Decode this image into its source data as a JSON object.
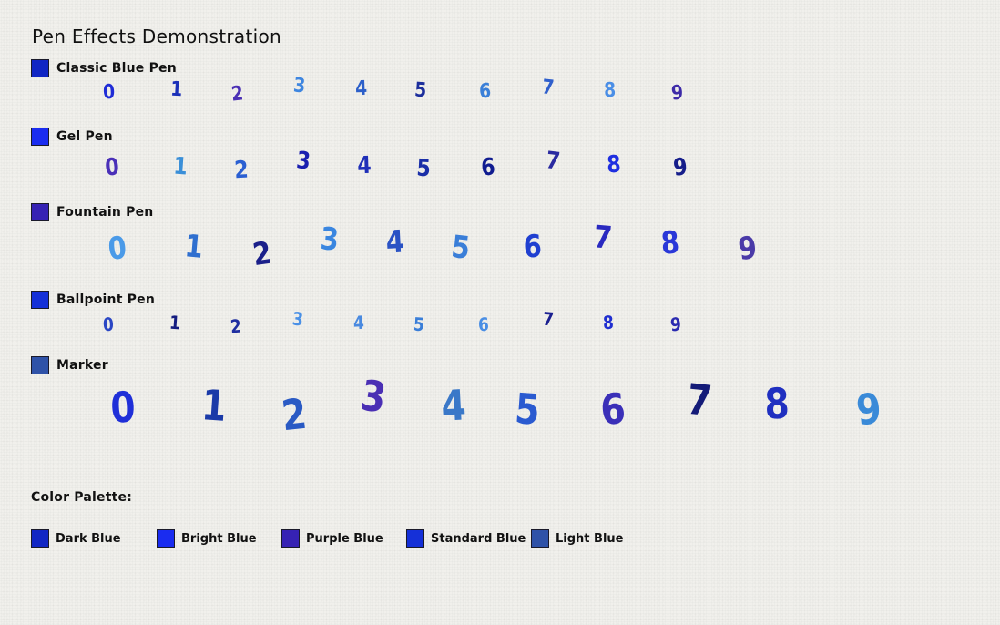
{
  "title": "Pen Effects Demonstration",
  "pens": [
    {
      "name": "Classic Blue Pen",
      "swatch": "#1126c4",
      "digits": [
        {
          "text": "0",
          "color": "#1f2cd6"
        },
        {
          "text": "1",
          "color": "#1a2fb8"
        },
        {
          "text": "2",
          "color": "#4a2fb4"
        },
        {
          "text": "3",
          "color": "#3e86e0"
        },
        {
          "text": "4",
          "color": "#2c5fc9"
        },
        {
          "text": "5",
          "color": "#1c2e9c"
        },
        {
          "text": "6",
          "color": "#3a7fd8"
        },
        {
          "text": "7",
          "color": "#2f5fcc"
        },
        {
          "text": "8",
          "color": "#4a8ee6"
        },
        {
          "text": "9",
          "color": "#3d2aa8"
        }
      ]
    },
    {
      "name": "Gel Pen",
      "swatch": "#1a2cf0",
      "digits": [
        {
          "text": "0",
          "color": "#4a30b8"
        },
        {
          "text": "1",
          "color": "#3a8fd8"
        },
        {
          "text": "2",
          "color": "#2a5fd2"
        },
        {
          "text": "3",
          "color": "#1a1fb0"
        },
        {
          "text": "4",
          "color": "#1f2fb8"
        },
        {
          "text": "5",
          "color": "#1a2fa8"
        },
        {
          "text": "6",
          "color": "#101c90"
        },
        {
          "text": "7",
          "color": "#2a2aa0"
        },
        {
          "text": "8",
          "color": "#1f2fe0"
        },
        {
          "text": "9",
          "color": "#151d8a"
        }
      ]
    },
    {
      "name": "Fountain Pen",
      "swatch": "#3622b4",
      "digits": [
        {
          "text": "0",
          "color": "#4a9ae8"
        },
        {
          "text": "1",
          "color": "#2f6fcf"
        },
        {
          "text": "2",
          "color": "#1a1f8a"
        },
        {
          "text": "3",
          "color": "#3a86e0"
        },
        {
          "text": "4",
          "color": "#2a52c4"
        },
        {
          "text": "5",
          "color": "#3a7ed8"
        },
        {
          "text": "6",
          "color": "#1f3fd0"
        },
        {
          "text": "7",
          "color": "#2a2ac0"
        },
        {
          "text": "8",
          "color": "#2a38d8"
        },
        {
          "text": "9",
          "color": "#4a3aa8"
        }
      ]
    },
    {
      "name": "Ballpoint Pen",
      "swatch": "#1530d8",
      "digits": [
        {
          "text": "0",
          "color": "#2a46c4"
        },
        {
          "text": "1",
          "color": "#151d80"
        },
        {
          "text": "2",
          "color": "#1f2ea0"
        },
        {
          "text": "3",
          "color": "#4a90e6"
        },
        {
          "text": "4",
          "color": "#4a8ae0"
        },
        {
          "text": "5",
          "color": "#3a7ed8"
        },
        {
          "text": "6",
          "color": "#4a8ee4"
        },
        {
          "text": "7",
          "color": "#1a1f90"
        },
        {
          "text": "8",
          "color": "#1f2ed0"
        },
        {
          "text": "9",
          "color": "#2a2ab0"
        }
      ]
    },
    {
      "name": "Marker",
      "swatch": "#2f52a8",
      "digits": [
        {
          "text": "0",
          "color": "#1f2fd8"
        },
        {
          "text": "1",
          "color": "#1a3aa8"
        },
        {
          "text": "2",
          "color": "#2a5ac4"
        },
        {
          "text": "3",
          "color": "#4a2fb4"
        },
        {
          "text": "4",
          "color": "#3a78c8"
        },
        {
          "text": "5",
          "color": "#2a5ad0"
        },
        {
          "text": "6",
          "color": "#3a2fb8"
        },
        {
          "text": "7",
          "color": "#141b78"
        },
        {
          "text": "8",
          "color": "#1f2fc0"
        },
        {
          "text": "9",
          "color": "#3a8ad8"
        }
      ]
    }
  ],
  "palette": {
    "title": "Color Palette:",
    "items": [
      {
        "label": "Dark Blue",
        "color": "#1126c4"
      },
      {
        "label": "Bright Blue",
        "color": "#1a2cf0"
      },
      {
        "label": "Purple Blue",
        "color": "#3622b4"
      },
      {
        "label": "Standard Blue",
        "color": "#1530d8"
      },
      {
        "label": "Light Blue",
        "color": "#2f52a8"
      }
    ]
  }
}
